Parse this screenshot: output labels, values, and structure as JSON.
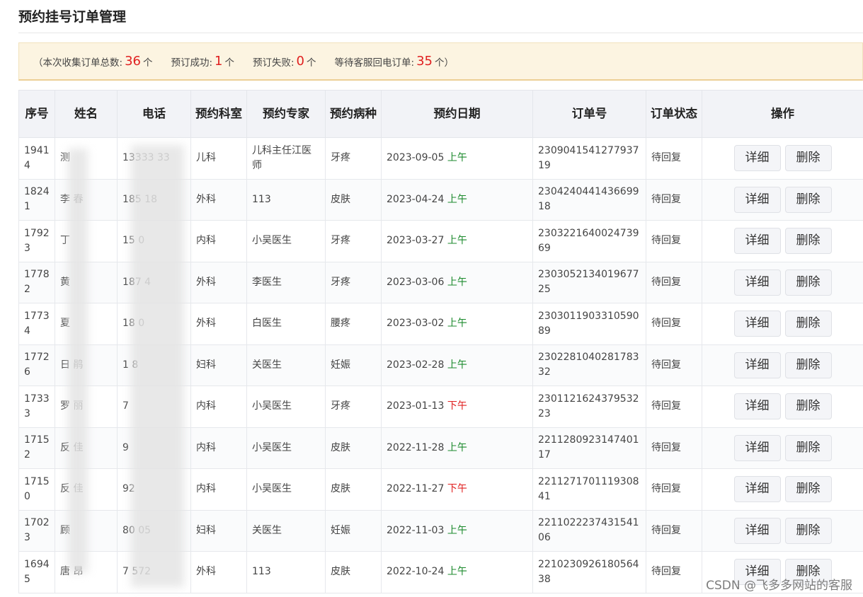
{
  "title": "预约挂号订单管理",
  "summary": {
    "open": "（本次收集订单总数:",
    "total": "36",
    "unit1": "个",
    "success_label": "预订成功:",
    "success": "1",
    "unit2": "个",
    "fail_label": "预订失败:",
    "fail": "0",
    "unit3": "个",
    "wait_label": "等待客服回电订单:",
    "wait": "35",
    "unit4": "个）"
  },
  "columns": [
    "序号",
    "姓名",
    "电话",
    "预约科室",
    "预约专家",
    "预约病种",
    "预约日期",
    "订单号",
    "订单状态",
    "操作"
  ],
  "actions": {
    "detail": "详细",
    "delete": "删除"
  },
  "rows": [
    {
      "id": "19414",
      "name": "测",
      "phone": "13333 33",
      "dept": "儿科",
      "expert": "儿科主任江医师",
      "disease": "牙疼",
      "date": "2023-09-05",
      "period": "上午",
      "period_type": "am",
      "order": "230904154127793719",
      "status": "待回复"
    },
    {
      "id": "18241",
      "name": "李 春",
      "phone": "185 18",
      "dept": "外科",
      "expert": "113",
      "disease": "皮肤",
      "date": "2023-04-24",
      "period": "上午",
      "period_type": "am",
      "order": "230424044143669918",
      "status": "待回复"
    },
    {
      "id": "17923",
      "name": "丁",
      "phone": "15 0",
      "dept": "内科",
      "expert": "小吴医生",
      "disease": "牙疼",
      "date": "2023-03-27",
      "period": "上午",
      "period_type": "am",
      "order": "230322164002473969",
      "status": "待回复"
    },
    {
      "id": "17782",
      "name": "黄",
      "phone": "187 4",
      "dept": "外科",
      "expert": "李医生",
      "disease": "牙疼",
      "date": "2023-03-06",
      "period": "上午",
      "period_type": "am",
      "order": "230305213401967725",
      "status": "待回复"
    },
    {
      "id": "17734",
      "name": "夏",
      "phone": "18 0",
      "dept": "外科",
      "expert": "白医生",
      "disease": "腰疼",
      "date": "2023-03-02",
      "period": "上午",
      "period_type": "am",
      "order": "230301190331059089",
      "status": "待回复"
    },
    {
      "id": "17726",
      "name": "日 鹃",
      "phone": "1 8",
      "dept": "妇科",
      "expert": "关医生",
      "disease": "妊娠",
      "date": "2023-02-28",
      "period": "上午",
      "period_type": "am",
      "order": "230228104028178332",
      "status": "待回复"
    },
    {
      "id": "17333",
      "name": "罗 丽",
      "phone": "7",
      "dept": "内科",
      "expert": "小吴医生",
      "disease": "牙疼",
      "date": "2023-01-13",
      "period": "下午",
      "period_type": "pm",
      "order": "230112162437953223",
      "status": "待回复"
    },
    {
      "id": "17152",
      "name": "反 佳",
      "phone": "9",
      "dept": "内科",
      "expert": "小吴医生",
      "disease": "皮肤",
      "date": "2022-11-28",
      "period": "上午",
      "period_type": "am",
      "order": "221128092314740117",
      "status": "待回复"
    },
    {
      "id": "17150",
      "name": "反 佳",
      "phone": "92",
      "dept": "内科",
      "expert": "小吴医生",
      "disease": "皮肤",
      "date": "2022-11-27",
      "period": "下午",
      "period_type": "pm",
      "order": "221127170111930841",
      "status": "待回复"
    },
    {
      "id": "17023",
      "name": "顾",
      "phone": "80 05",
      "dept": "妇科",
      "expert": "关医生",
      "disease": "妊娠",
      "date": "2022-11-03",
      "period": "上午",
      "period_type": "am",
      "order": "221102223743154106",
      "status": "待回复"
    },
    {
      "id": "16945",
      "name": "唐 昂",
      "phone": "7 572",
      "dept": "外科",
      "expert": "113",
      "disease": "皮肤",
      "date": "2022-10-24",
      "period": "上午",
      "period_type": "am",
      "order": "221023092618056438",
      "status": "待回复"
    }
  ],
  "watermark": "CSDN @飞多多网站的客服"
}
